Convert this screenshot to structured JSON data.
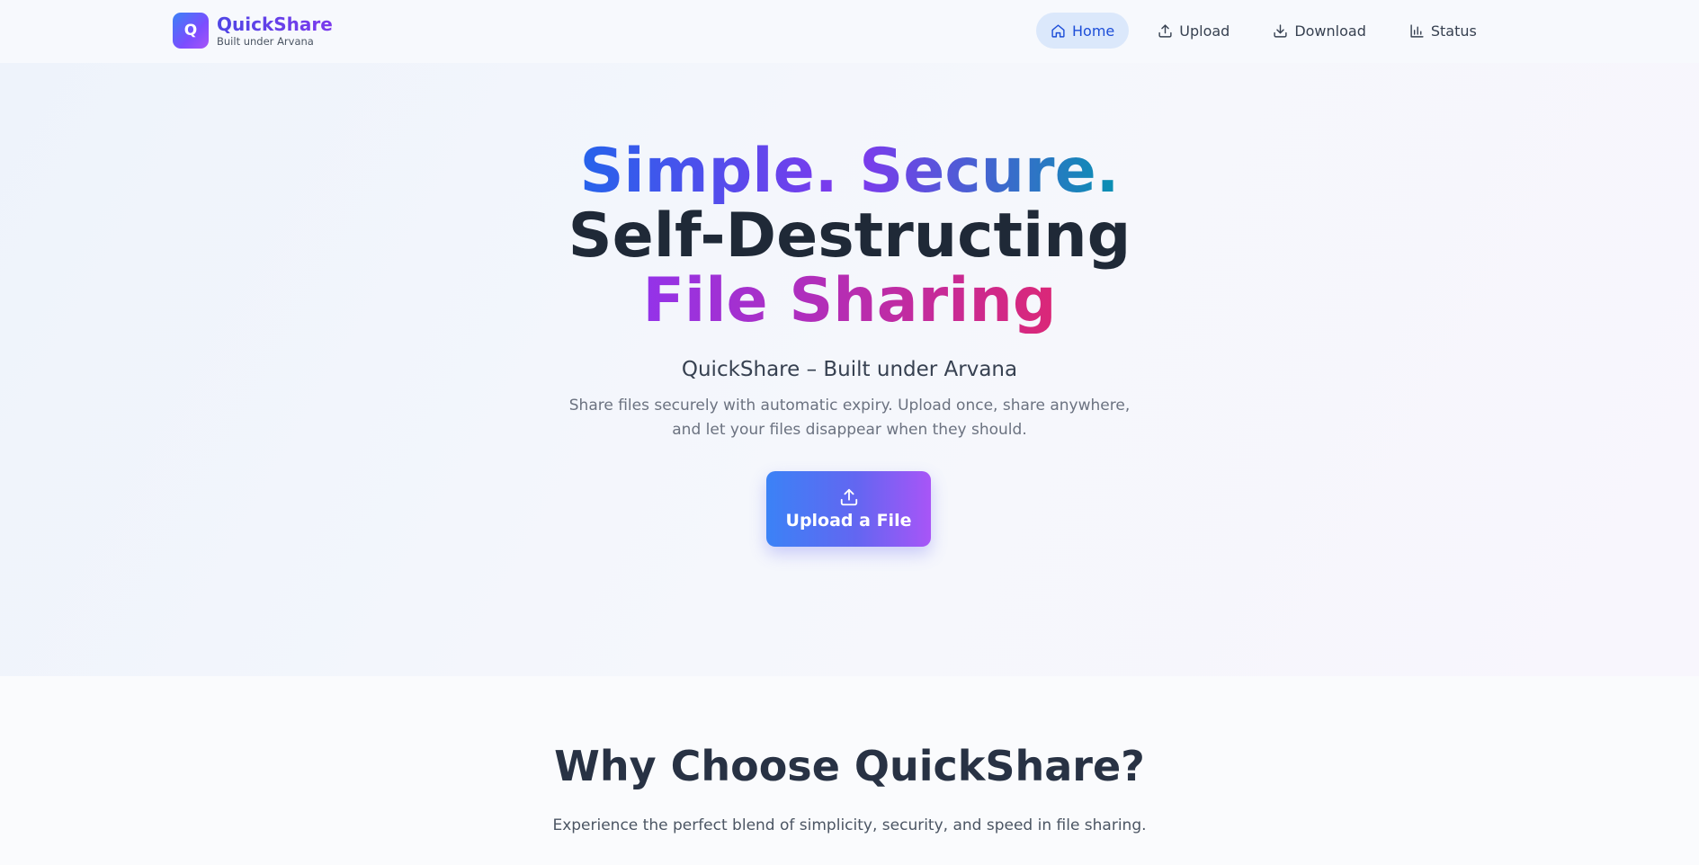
{
  "brand": {
    "logo_letter": "Q",
    "name": "QuickShare",
    "tagline": "Built under Arvana"
  },
  "nav": {
    "items": [
      {
        "label": "Home",
        "icon": "home-icon",
        "active": true
      },
      {
        "label": "Upload",
        "icon": "upload-icon",
        "active": false
      },
      {
        "label": "Download",
        "icon": "download-icon",
        "active": false
      },
      {
        "label": "Status",
        "icon": "bar-chart-icon",
        "active": false
      }
    ]
  },
  "hero": {
    "title_part_1": "Simple.",
    "title_part_2": "Secure.",
    "title_line_2": "Self-Destructing",
    "title_line_3": "File Sharing",
    "subtitle": "QuickShare – Built under Arvana",
    "description": "Share files securely with automatic expiry. Upload once, share anywhere, and let your files disappear when they should.",
    "cta_label": "Upload a File",
    "cta_icon": "upload-icon"
  },
  "features": {
    "title": "Why Choose QuickShare?",
    "description": "Experience the perfect blend of simplicity, security, and speed in file sharing."
  },
  "colors": {
    "accent_blue": "#3b82f6",
    "accent_purple": "#a855f7",
    "accent_pink": "#db2777",
    "nav_active_bg": "#dbe8fb",
    "nav_active_text": "#1d4ed8",
    "heading_dark": "#1f2937"
  }
}
